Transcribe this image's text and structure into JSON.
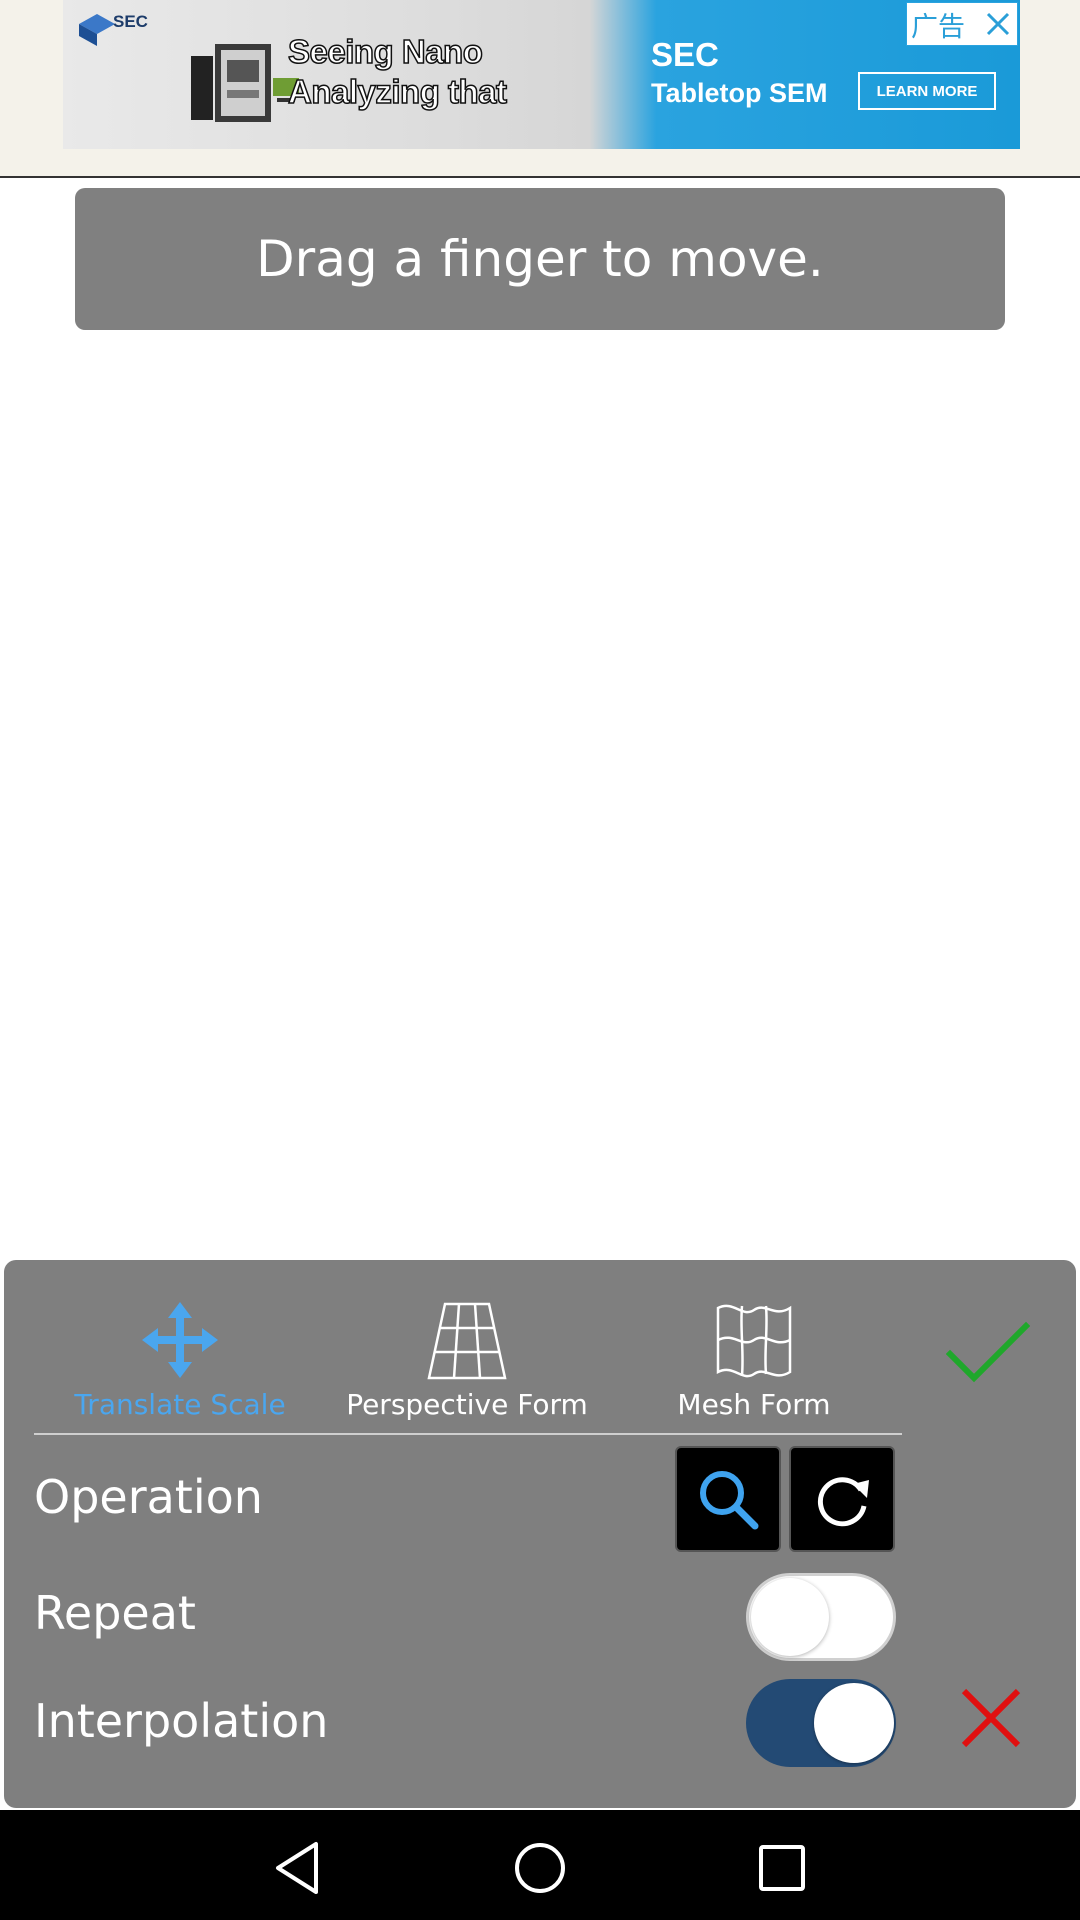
{
  "ad": {
    "logo_text": "SEC",
    "headline_line1": "Seeing Nano",
    "headline_line2": "Analyzing that",
    "brand": "SEC",
    "product": "Tabletop SEM",
    "cta": "LEARN MORE",
    "tag_label": "广告",
    "colors": {
      "blue": "#1a9ad8"
    }
  },
  "hint": {
    "text": "Drag a finger to move."
  },
  "modes": [
    {
      "label": "Translate Scale",
      "icon": "move-arrows-icon",
      "active": true
    },
    {
      "label": "Perspective Form",
      "icon": "perspective-grid-icon",
      "active": false
    },
    {
      "label": "Mesh Form",
      "icon": "mesh-warp-icon",
      "active": false
    }
  ],
  "controls": {
    "operation_label": "Operation",
    "operation_buttons": [
      "zoom-icon",
      "rotate-icon"
    ],
    "repeat_label": "Repeat",
    "repeat_on": false,
    "interpolation_label": "Interpolation",
    "interpolation_on": true
  },
  "colors": {
    "panel": "#7f7f7f",
    "active_accent": "#4aa6ef",
    "confirm": "#1fa82b",
    "cancel": "#e01010",
    "toggle_on": "#234a74"
  }
}
